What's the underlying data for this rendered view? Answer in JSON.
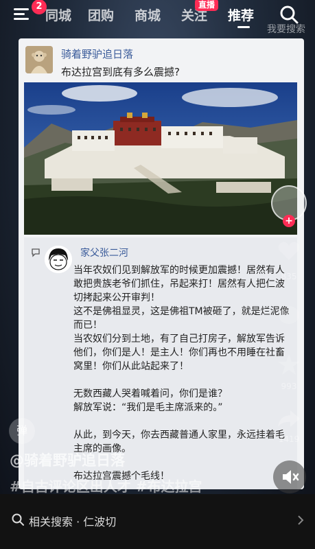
{
  "nav": {
    "badge_count": "2",
    "tabs": [
      {
        "label": "同城"
      },
      {
        "label": "团购"
      },
      {
        "label": "商城"
      },
      {
        "label": "关注"
      },
      {
        "label": "推荐"
      }
    ],
    "live_badge": "直播",
    "watermark": "我要搜索"
  },
  "post": {
    "username": "骑着野驴追日落",
    "title": "布达拉宫到底有多么震撼?"
  },
  "reply": {
    "username": "家父张二河",
    "text": "当年农奴们见到解放军的时候更加震撼！居然有人敢把贵族老爷们抓住，吊起来打！居然有人把仁波切拷起来公开审判！\n这不是佛祖显灵，这是佛祖TM被砸了，就是烂泥像而已！\n当农奴们分到土地，有了自己打房子，解放军告诉他们，你们是人！是主人！你们再也不用睡在社畜窝里！你们从此站起来了！\n\n无数西藏人哭着喊着问，你们是谁？\n解放军说：“我们是毛主席派来的。”\n\n从此，到今天，你去西藏普通人家里，永远挂着毛主席的画像。\n\n布达拉宫震撼个毛线！"
  },
  "rail": {
    "like_count": "835",
    "comment_count": "993",
    "share_count": "1419"
  },
  "danmu_label": "弹",
  "author_line": "@骑着野驴追日落",
  "hashtags": "#自古评论区出人才 #布达拉宫",
  "related": {
    "label": "相关搜索 · 仁波切"
  },
  "colors": {
    "accent": "#fe2c55",
    "link": "#3a5b9a"
  }
}
